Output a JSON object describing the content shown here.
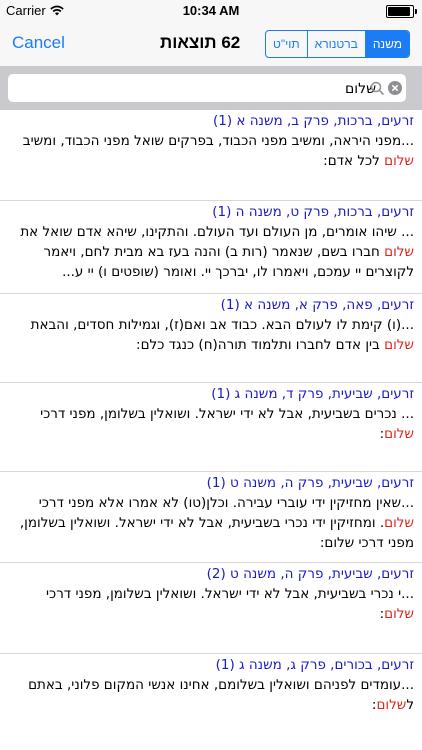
{
  "status_bar": {
    "carrier": "Carrier",
    "time": "10:34 AM"
  },
  "nav": {
    "cancel": "Cancel",
    "title": "62 תוצאות",
    "segments": [
      {
        "label": "תוי\"ט",
        "active": false
      },
      {
        "label": "ברטנורא",
        "active": false
      },
      {
        "label": "משנה",
        "active": true
      }
    ]
  },
  "search": {
    "value": "שלום",
    "placeholder": ""
  },
  "results": [
    {
      "ref": "זרעים, ברכות, פרק ב, משנה א (1)",
      "before": "...מפני היראה, ומשיב מפני הכבוד, בפרקים שואל מפני הכבוד, ומשיב ",
      "highlight": "שלום",
      "after": " לכל אדם:"
    },
    {
      "ref": "זרעים, ברכות, פרק ט, משנה ה (1)",
      "before": "... שיהו אומרים, מן העולם ועד העולם. והתקינו, שיהא אדם שואל את ",
      "highlight": "שלום",
      "after": " חברו בשם, שנאמר (רות ב) והנה בעז בא מבית לחם, ויאמר לקוצרים יי עמכם, ויאמרו לו, יברכך יי. ואומר (שופטים ו) יי ע..."
    },
    {
      "ref": "זרעים, פאה, פרק א, משנה א (1)",
      "before": "...(ו) קימת לו לעולם הבא. כבוד אב ואם(ז), וגמילות חסדים, והבאת ",
      "highlight": "שלום",
      "after": " בין אדם לחברו ותלמוד תורה(ח) כנגד כלם:"
    },
    {
      "ref": "זרעים, שביעית, פרק ד, משנה ג (1)",
      "before": "... נכרים בשביעית, אבל לא ידי ישראל. ושואלין בשלומן, מפני דרכי ",
      "highlight": "שלום",
      "after": ":"
    },
    {
      "ref": "זרעים, שביעית, פרק ה, משנה ט (1)",
      "before": "...שאין מחזיקין ידי עוברי עבירה. וכלן(טו) לא אמרו אלא מפני דרכי ",
      "highlight": "שלום",
      "after": ". ומחזיקין ידי נכרי בשביעית, אבל לא ידי ישראל. ושואלין בשלומן, מפני דרכי שלום:"
    },
    {
      "ref": "זרעים, שביעית, פרק ה, משנה ט (2)",
      "before": "...י נכרי בשביעית, אבל לא ידי ישראל. ושואלין בשלומן, מפני דרכי ",
      "highlight": "שלום",
      "after": ":"
    },
    {
      "ref": "זרעים, בכורים, פרק ג, משנה ג (1)",
      "before": "...עומדים לפניהם ושואלין בשלומם, אחינו אנשי המקום פלוני, באתם ל",
      "highlight": "שלום",
      "after": ":"
    }
  ]
}
